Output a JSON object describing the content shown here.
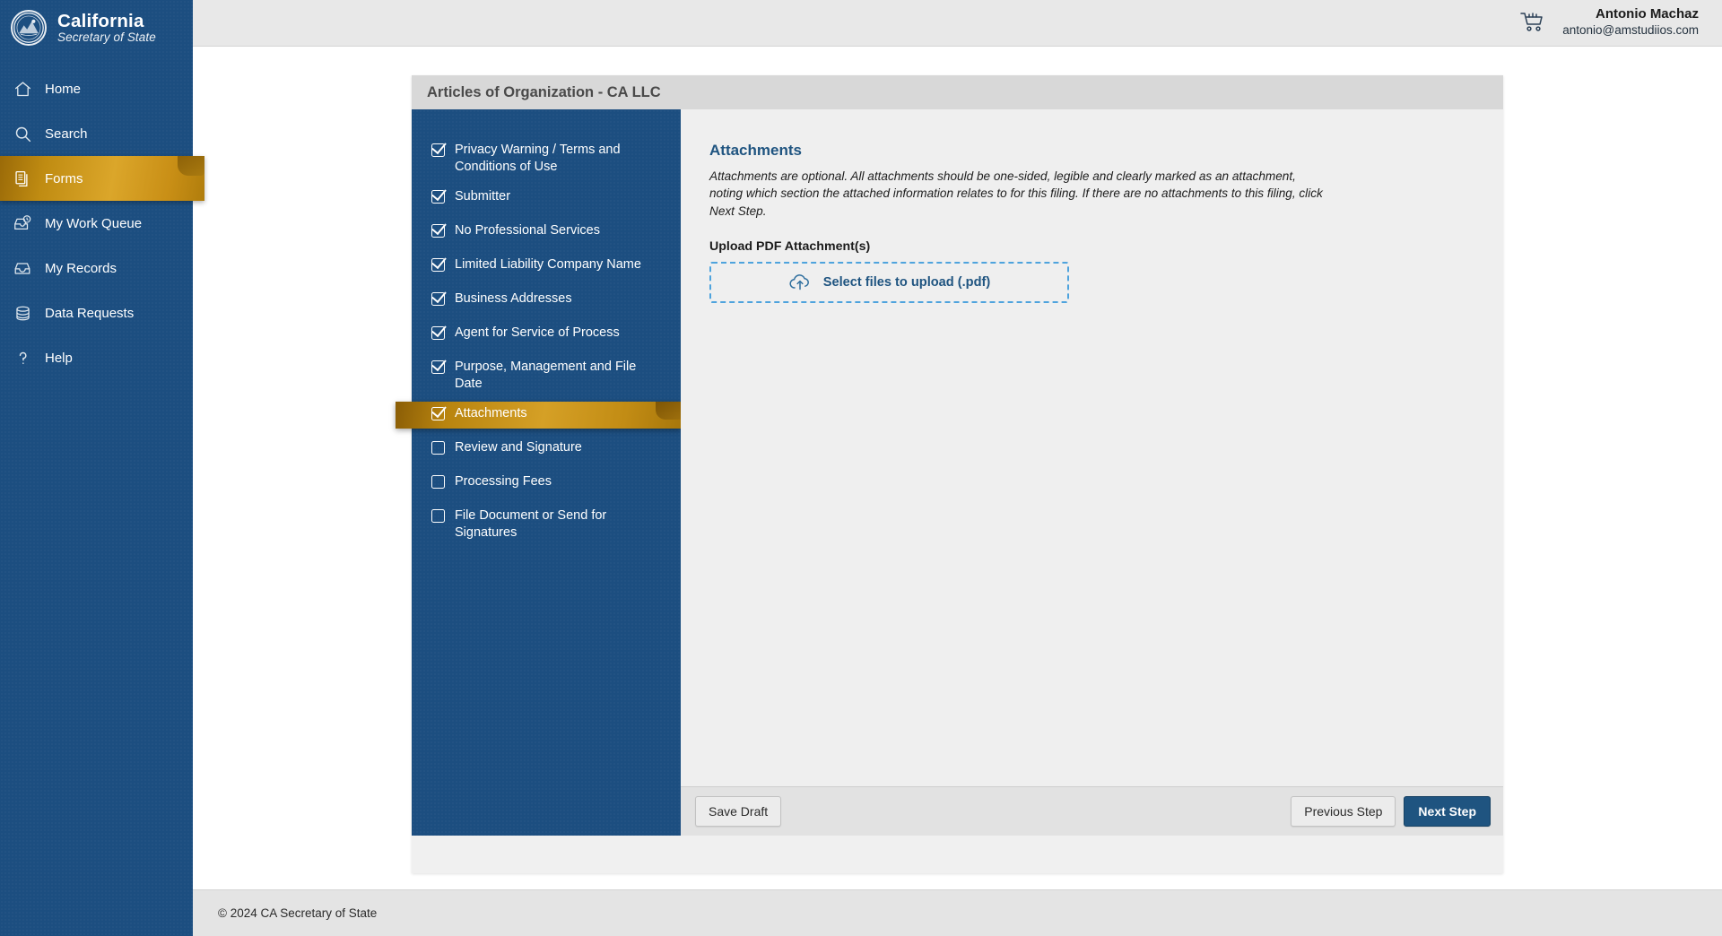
{
  "brand": {
    "name": "California",
    "subtitle": "Secretary of State",
    "seal_icon": "california-state-seal-icon"
  },
  "sidebar": {
    "items": [
      {
        "label": "Home",
        "icon": "home-icon",
        "active": false
      },
      {
        "label": "Search",
        "icon": "search-icon",
        "active": false
      },
      {
        "label": "Forms",
        "icon": "forms-icon",
        "active": true
      },
      {
        "label": "My Work Queue",
        "icon": "work-queue-icon",
        "active": false
      },
      {
        "label": "My Records",
        "icon": "records-tray-icon",
        "active": false
      },
      {
        "label": "Data Requests",
        "icon": "database-icon",
        "active": false
      },
      {
        "label": "Help",
        "icon": "question-mark-icon",
        "active": false
      }
    ]
  },
  "topbar": {
    "cart_icon": "shopping-cart-icon",
    "user_name": "Antonio Machaz",
    "user_email": "antonio@amstudiios.com"
  },
  "card": {
    "title": "Articles of Organization - CA LLC"
  },
  "steps": [
    {
      "label": "Privacy Warning / Terms and Conditions of Use",
      "checked": true,
      "active": false
    },
    {
      "label": "Submitter",
      "checked": true,
      "active": false
    },
    {
      "label": "No Professional Services",
      "checked": true,
      "active": false
    },
    {
      "label": "Limited Liability Company Name",
      "checked": true,
      "active": false
    },
    {
      "label": "Business Addresses",
      "checked": true,
      "active": false
    },
    {
      "label": "Agent for Service of Process",
      "checked": true,
      "active": false
    },
    {
      "label": "Purpose, Management and File Date",
      "checked": true,
      "active": false
    },
    {
      "label": "Attachments",
      "checked": true,
      "active": true
    },
    {
      "label": "Review and Signature",
      "checked": false,
      "active": false
    },
    {
      "label": "Processing Fees",
      "checked": false,
      "active": false
    },
    {
      "label": "File Document or Send for Signatures",
      "checked": false,
      "active": false
    }
  ],
  "main": {
    "heading": "Attachments",
    "description": "Attachments are optional. All attachments should be one-sided, legible and clearly marked as an attachment, noting which section the attached information relates to for this filing. If there are no attachments to this filing, click Next Step.",
    "upload_label": "Upload PDF Attachment(s)",
    "dropzone_label": "Select files to upload (.pdf)",
    "dropzone_icon": "cloud-upload-icon"
  },
  "actions": {
    "save_draft": "Save Draft",
    "previous_step": "Previous Step",
    "next_step": "Next Step"
  },
  "footer": {
    "copyright": "© 2024 CA Secretary of State"
  },
  "colors": {
    "brand_blue": "#1c4e80",
    "accent_gold": "#d5a026",
    "heading_blue": "#1f5480",
    "dropzone_border": "#4ea3dd"
  }
}
